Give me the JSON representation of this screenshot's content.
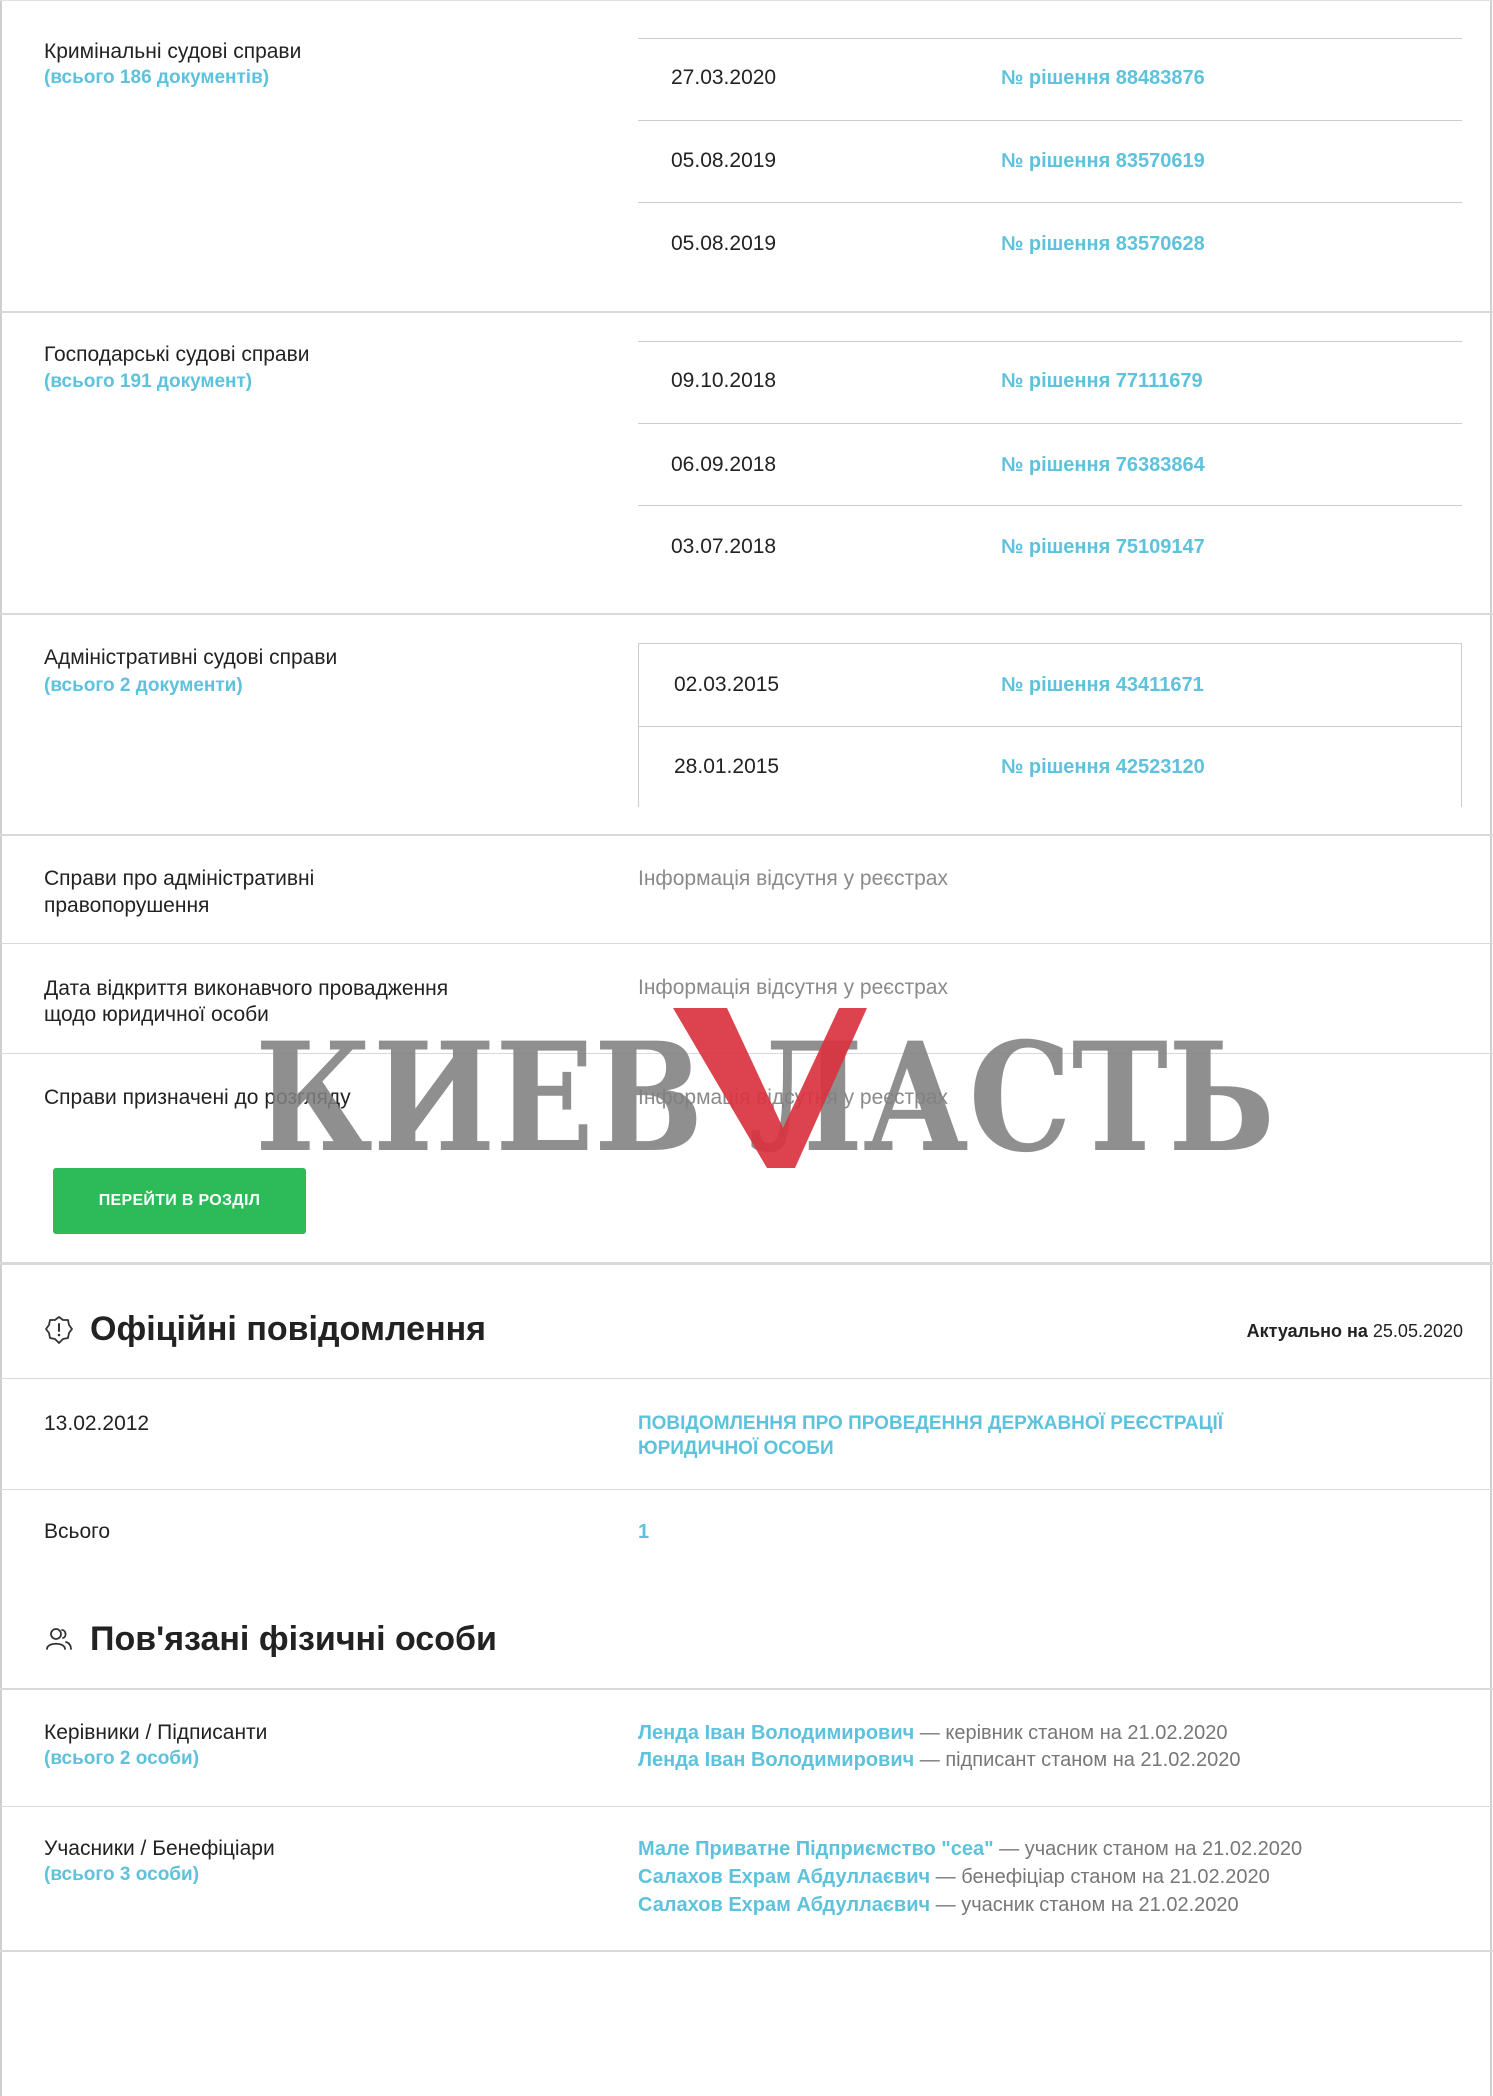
{
  "criminal": {
    "label": "Кримінальні судові справи",
    "count": "(всього 186 документів)",
    "rows": [
      {
        "date": "27.03.2020",
        "decision": "№ рішення 88483876"
      },
      {
        "date": "05.08.2019",
        "decision": "№ рішення 83570619"
      },
      {
        "date": "05.08.2019",
        "decision": "№ рішення 83570628"
      }
    ]
  },
  "commercial": {
    "label": "Господарські судові справи",
    "count": "(всього 191 документ)",
    "rows": [
      {
        "date": "09.10.2018",
        "decision": "№ рішення 77111679"
      },
      {
        "date": "06.09.2018",
        "decision": "№ рішення 76383864"
      },
      {
        "date": "03.07.2018",
        "decision": "№ рішення 75109147"
      }
    ]
  },
  "administrative": {
    "label": "Адміністративні судові справи",
    "count": "(всього 2 документи)",
    "rows": [
      {
        "date": "02.03.2015",
        "decision": "№ рішення 43411671"
      },
      {
        "date": "28.01.2015",
        "decision": "№ рішення 42523120"
      }
    ]
  },
  "info_rows": [
    {
      "label_line1": "Справи про адміністративні",
      "label_line2": "правопорушення",
      "value": "Інформація відсутня у реєстрах"
    },
    {
      "label_line1": "Дата відкриття виконавчого провадження",
      "label_line2": "щодо юридичної особи",
      "value": "Інформація відсутня у реєстрах"
    },
    {
      "label_line1": "Справи призначені до розгляду",
      "label_line2": "",
      "value": "Інформація відсутня у реєстрах"
    }
  ],
  "go_section_button": "ПЕРЕЙТИ В РОЗДІЛ",
  "watermark": "КИЕВВЛАСТЬ",
  "official": {
    "title": "Офіційні повідомлення",
    "actual_label": "Актуально на",
    "actual_date": "25.05.2020",
    "notice_date": "13.02.2012",
    "notice_line1": "ПОВІДОМЛЕННЯ ПРО ПРОВЕДЕННЯ ДЕРЖАВНОЇ РЕЄСТРАЦІЇ",
    "notice_line2": "ЮРИДИЧНОЇ ОСОБИ",
    "total_label": "Всього",
    "total_value": "1"
  },
  "persons": {
    "title": "Пов'язані фізичні особи",
    "managers": {
      "label": "Керівники / Підписанти",
      "count": "(всього 2 особи)",
      "items": [
        {
          "name": "Ленда Іван Володимирович",
          "role": " — керівник станом на 21.02.2020"
        },
        {
          "name": "Ленда Іван Володимирович",
          "role": " — підписант станом на 21.02.2020"
        }
      ]
    },
    "participants": {
      "label": "Учасники / Бенефіціари",
      "count": "(всього 3 особи)",
      "items": [
        {
          "name": "Мале Приватне Підприємство \"сеа\"",
          "role": " — учасник станом на 21.02.2020"
        },
        {
          "name": "Салахов Ехрам Абдуллаєвич",
          "role": " — бенефіціар станом на 21.02.2020"
        },
        {
          "name": "Салахов Ехрам Абдуллаєвич",
          "role": " — учасник станом на 21.02.2020"
        }
      ]
    }
  },
  "colors": {
    "accent": "#5ec2dc",
    "button": "#2dbb5a",
    "watermark_gray": "#7f7f7f",
    "watermark_red": "#d9333f"
  }
}
